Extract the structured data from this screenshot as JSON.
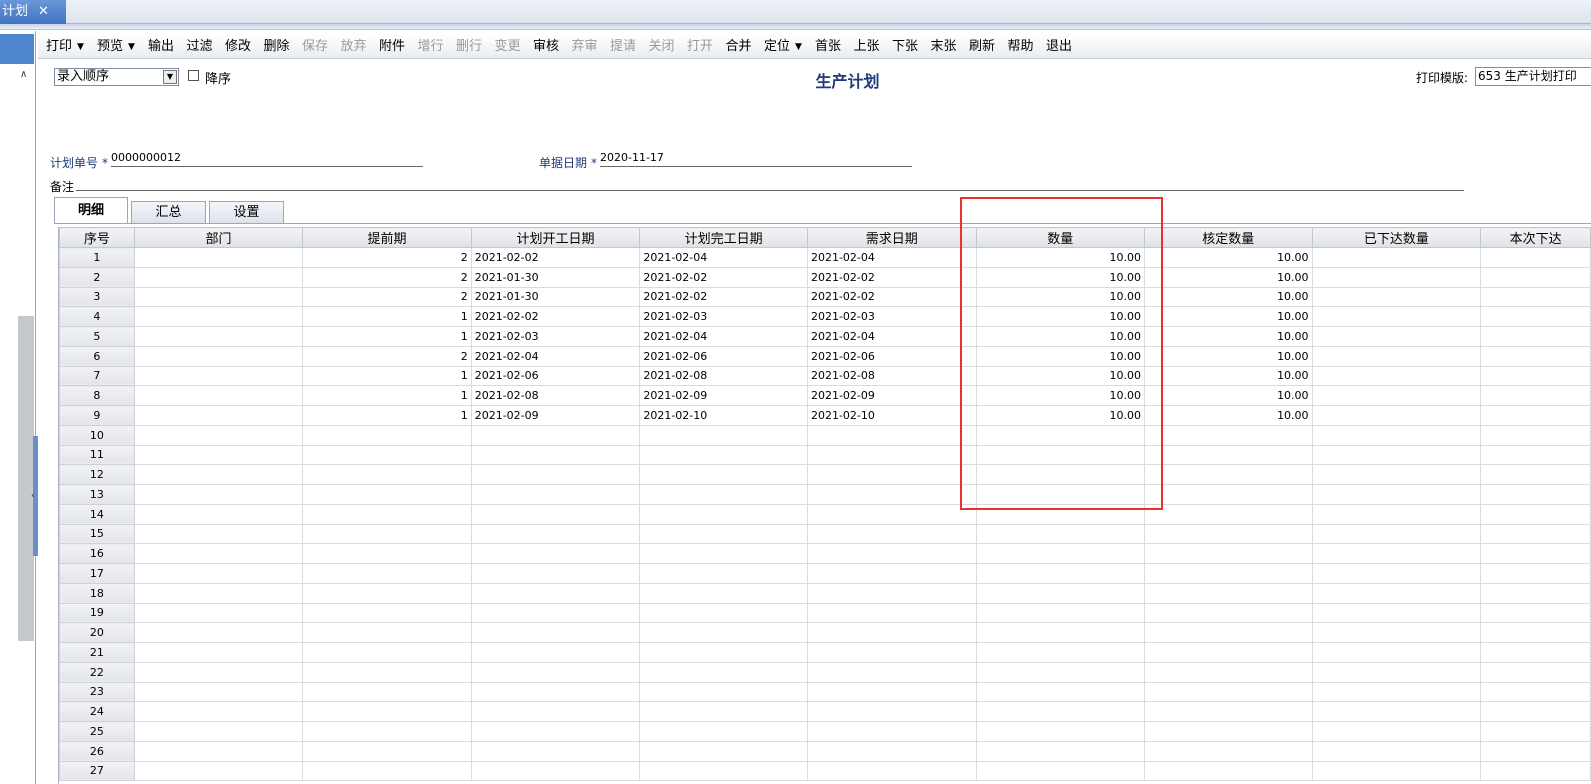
{
  "window": {
    "tab_title": "计划",
    "close_glyph": "✕"
  },
  "toolbar": [
    {
      "label": "打印",
      "dropdown": true,
      "enabled": true
    },
    {
      "label": "预览",
      "dropdown": true,
      "enabled": true
    },
    {
      "label": "输出",
      "enabled": true
    },
    {
      "label": "过滤",
      "enabled": true
    },
    {
      "label": "修改",
      "enabled": true
    },
    {
      "label": "删除",
      "enabled": true
    },
    {
      "label": "保存",
      "enabled": false
    },
    {
      "label": "放弃",
      "enabled": false
    },
    {
      "label": "附件",
      "enabled": true
    },
    {
      "label": "增行",
      "enabled": false
    },
    {
      "label": "删行",
      "enabled": false
    },
    {
      "label": "变更",
      "enabled": false
    },
    {
      "label": "审核",
      "enabled": true
    },
    {
      "label": "弃审",
      "enabled": false
    },
    {
      "label": "提请",
      "enabled": false
    },
    {
      "label": "关闭",
      "enabled": false
    },
    {
      "label": "打开",
      "enabled": false
    },
    {
      "label": "合并",
      "enabled": true
    },
    {
      "label": "定位",
      "dropdown": true,
      "enabled": true
    },
    {
      "label": "首张",
      "enabled": true
    },
    {
      "label": "上张",
      "enabled": true
    },
    {
      "label": "下张",
      "enabled": true
    },
    {
      "label": "末张",
      "enabled": true
    },
    {
      "label": "刷新",
      "enabled": true
    },
    {
      "label": "帮助",
      "enabled": true
    },
    {
      "label": "退出",
      "enabled": true
    }
  ],
  "header": {
    "sort_order": "录入顺序",
    "descending_label": "降序",
    "descending_checked": false,
    "title": "生产计划",
    "print_template_label": "打印模版:",
    "print_template_value": "653 生产计划打印"
  },
  "form": {
    "plan_no_label": "计划单号",
    "plan_no_value": "0000000012",
    "doc_date_label": "单据日期",
    "doc_date_value": "2020-11-17",
    "note_label": "备注",
    "required_mark": "*"
  },
  "tabs": [
    "明细",
    "汇总",
    "设置"
  ],
  "active_tab": "明细",
  "grid": {
    "columns": [
      "序号",
      "部门",
      "提前期",
      "计划开工日期",
      "计划完工日期",
      "需求日期",
      "数量",
      "核定数量",
      "已下达数量",
      "本次下达"
    ],
    "rows": [
      [
        "1",
        "",
        "2",
        "2021-02-02",
        "2021-02-04",
        "2021-02-04",
        "10.00",
        "10.00",
        "",
        ""
      ],
      [
        "2",
        "",
        "2",
        "2021-01-30",
        "2021-02-02",
        "2021-02-02",
        "10.00",
        "10.00",
        "",
        ""
      ],
      [
        "3",
        "",
        "2",
        "2021-01-30",
        "2021-02-02",
        "2021-02-02",
        "10.00",
        "10.00",
        "",
        ""
      ],
      [
        "4",
        "",
        "1",
        "2021-02-02",
        "2021-02-03",
        "2021-02-03",
        "10.00",
        "10.00",
        "",
        ""
      ],
      [
        "5",
        "",
        "1",
        "2021-02-03",
        "2021-02-04",
        "2021-02-04",
        "10.00",
        "10.00",
        "",
        ""
      ],
      [
        "6",
        "",
        "2",
        "2021-02-04",
        "2021-02-06",
        "2021-02-06",
        "10.00",
        "10.00",
        "",
        ""
      ],
      [
        "7",
        "",
        "1",
        "2021-02-06",
        "2021-02-08",
        "2021-02-08",
        "10.00",
        "10.00",
        "",
        ""
      ],
      [
        "8",
        "",
        "1",
        "2021-02-08",
        "2021-02-09",
        "2021-02-09",
        "10.00",
        "10.00",
        "",
        ""
      ],
      [
        "9",
        "",
        "1",
        "2021-02-09",
        "2021-02-10",
        "2021-02-10",
        "10.00",
        "10.00",
        "",
        ""
      ],
      [
        "10",
        "",
        "",
        "",
        "",
        "",
        "",
        "",
        "",
        ""
      ],
      [
        "11",
        "",
        "",
        "",
        "",
        "",
        "",
        "",
        "",
        ""
      ],
      [
        "12",
        "",
        "",
        "",
        "",
        "",
        "",
        "",
        "",
        ""
      ],
      [
        "13",
        "",
        "",
        "",
        "",
        "",
        "",
        "",
        "",
        ""
      ],
      [
        "14",
        "",
        "",
        "",
        "",
        "",
        "",
        "",
        "",
        ""
      ],
      [
        "15",
        "",
        "",
        "",
        "",
        "",
        "",
        "",
        "",
        ""
      ],
      [
        "16",
        "",
        "",
        "",
        "",
        "",
        "",
        "",
        "",
        ""
      ],
      [
        "17",
        "",
        "",
        "",
        "",
        "",
        "",
        "",
        "",
        ""
      ],
      [
        "18",
        "",
        "",
        "",
        "",
        "",
        "",
        "",
        "",
        ""
      ],
      [
        "19",
        "",
        "",
        "",
        "",
        "",
        "",
        "",
        "",
        ""
      ],
      [
        "20",
        "",
        "",
        "",
        "",
        "",
        "",
        "",
        "",
        ""
      ],
      [
        "21",
        "",
        "",
        "",
        "",
        "",
        "",
        "",
        "",
        ""
      ],
      [
        "22",
        "",
        "",
        "",
        "",
        "",
        "",
        "",
        "",
        ""
      ],
      [
        "23",
        "",
        "",
        "",
        "",
        "",
        "",
        "",
        "",
        ""
      ],
      [
        "24",
        "",
        "",
        "",
        "",
        "",
        "",
        "",
        "",
        ""
      ],
      [
        "25",
        "",
        "",
        "",
        "",
        "",
        "",
        "",
        "",
        ""
      ],
      [
        "26",
        "",
        "",
        "",
        "",
        "",
        "",
        "",
        "",
        ""
      ],
      [
        "27",
        "",
        "",
        "",
        "",
        "",
        "",
        "",
        "",
        ""
      ]
    ]
  },
  "colors": {
    "highlight": "#e8322d",
    "title": "#1f3b7a",
    "disabled_text": "#9a9a9a"
  },
  "icons": {
    "sort_dropdown": "chevron-down-icon",
    "panel_collapse": "chevron-up-icon"
  }
}
